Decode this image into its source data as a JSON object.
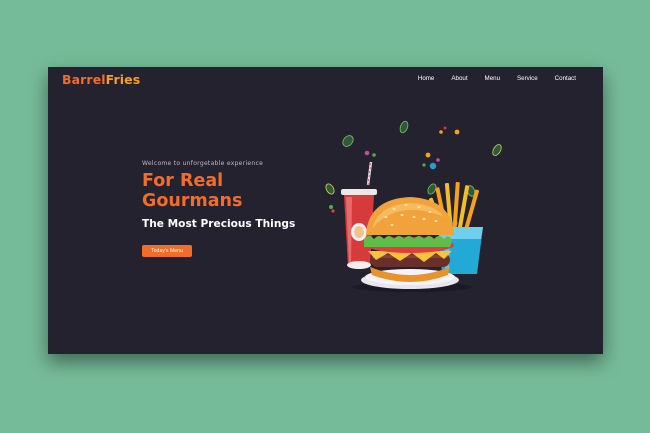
{
  "brand": {
    "part1": "Barrel",
    "part2": "Fries"
  },
  "nav": {
    "items": [
      "Home",
      "About",
      "Menu",
      "Service",
      "Contact"
    ]
  },
  "hero": {
    "kicker": "Welcome to unforgetable experience",
    "title_line1": "For Real",
    "title_line2": "Gourmans",
    "subtitle": "The Most Precious Things",
    "cta_label": "Today's Menu"
  },
  "colors": {
    "background": "#76bb99",
    "page": "#252230",
    "accent": "#f26c2a",
    "accent2": "#f7a01c"
  },
  "illustration": {
    "items": [
      "soda-cup-icon",
      "burger-icon",
      "fries-icon",
      "leaf-icon"
    ]
  }
}
